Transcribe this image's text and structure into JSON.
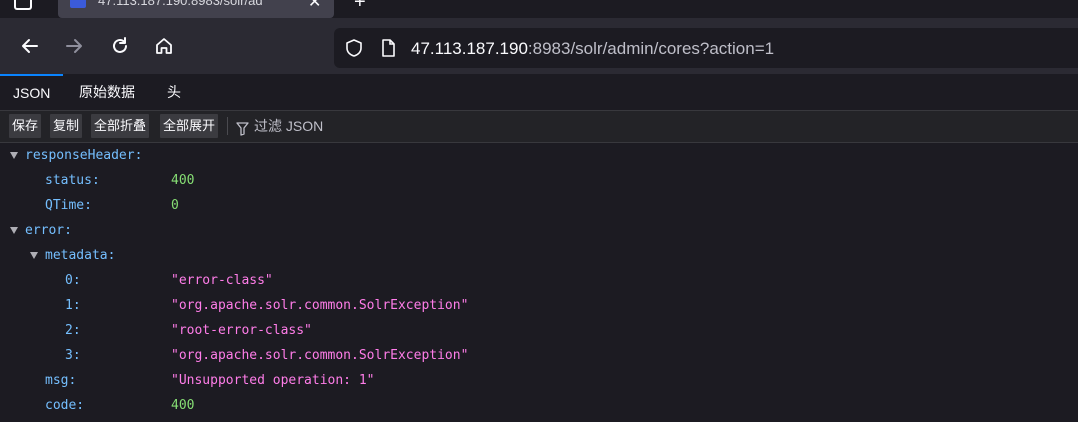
{
  "browser": {
    "tab_title": "47.113.187.190:8983/solr/ad",
    "url_host": "47.113.187.190",
    "url_rest": ":8983/solr/admin/cores?action=1"
  },
  "viewer_tabs": [
    "JSON",
    "原始数据",
    "头"
  ],
  "toolbar": {
    "save": "保存",
    "copy": "复制",
    "collapse_all": "全部折叠",
    "expand_all": "全部展开",
    "filter_placeholder": "过滤 JSON"
  },
  "json": {
    "responseHeader_key": "responseHeader:",
    "status_key": "status:",
    "status_val": "400",
    "qtime_key": "QTime:",
    "qtime_val": "0",
    "error_key": "error:",
    "metadata_key": "metadata:",
    "metadata": [
      {
        "key": "0:",
        "val": "\"error-class\""
      },
      {
        "key": "1:",
        "val": "\"org.apache.solr.common.SolrException\""
      },
      {
        "key": "2:",
        "val": "\"root-error-class\""
      },
      {
        "key": "3:",
        "val": "\"org.apache.solr.common.SolrException\""
      }
    ],
    "msg_key": "msg:",
    "msg_val": "\"Unsupported operation: 1\"",
    "code_key": "code:",
    "code_val": "400"
  },
  "colors": {
    "accent": "#0a84ff",
    "key": "#75bfff",
    "number": "#86de74",
    "string": "#ff7de9"
  },
  "icons": [
    "tab-list-icon",
    "favicon-icon",
    "close-icon",
    "new-tab-icon",
    "back-icon",
    "forward-icon",
    "reload-icon",
    "home-icon",
    "shield-icon",
    "page-icon",
    "filter-icon",
    "expand-twisty-icon"
  ]
}
